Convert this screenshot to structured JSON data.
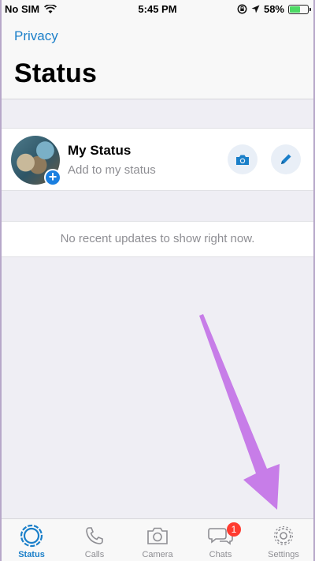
{
  "status_bar": {
    "carrier": "No SIM",
    "time": "5:45 PM",
    "battery_percent": "58%",
    "battery_level": 0.58
  },
  "header": {
    "back_label": "Privacy",
    "title": "Status"
  },
  "my_status": {
    "name": "My Status",
    "subtitle": "Add to my status"
  },
  "empty_message": "No recent updates to show right now.",
  "tabs": [
    {
      "label": "Status",
      "icon": "status-ring-icon",
      "active": true
    },
    {
      "label": "Calls",
      "icon": "phone-icon",
      "active": false
    },
    {
      "label": "Camera",
      "icon": "camera-icon",
      "active": false
    },
    {
      "label": "Chats",
      "icon": "chat-bubbles-icon",
      "active": false,
      "badge": "1"
    },
    {
      "label": "Settings",
      "icon": "gear-icon",
      "active": false
    }
  ],
  "colors": {
    "accent": "#1a7fc9",
    "badge": "#ff3b30",
    "arrow": "#c77de8",
    "background": "#efeef4"
  }
}
